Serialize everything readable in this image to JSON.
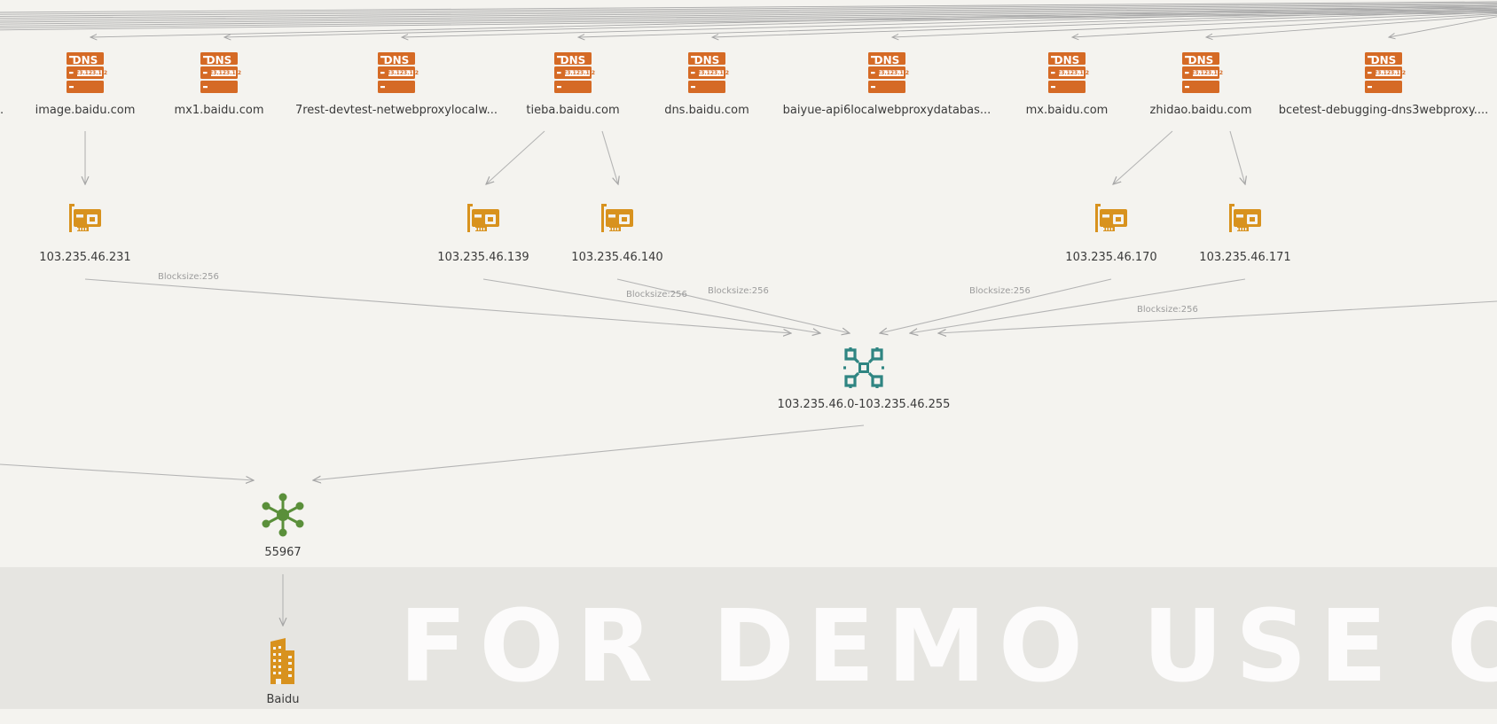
{
  "colors": {
    "background": "#f4f3ef",
    "dns": "#d56a25",
    "netcard": "#d8921e",
    "block": "#2f8582",
    "asn": "#5a8f3a",
    "org": "#d8921e",
    "edge": "#b4b4b4"
  },
  "graph": {
    "dns_nodes": [
      {
        "id": "dns-image",
        "label": "image.baidu.com"
      },
      {
        "id": "dns-mx1",
        "label": "mx1.baidu.com"
      },
      {
        "id": "dns-7rest",
        "label": "7rest-devtest-netwebproxylocalw..."
      },
      {
        "id": "dns-tieba",
        "label": "tieba.baidu.com"
      },
      {
        "id": "dns-dns",
        "label": "dns.baidu.com"
      },
      {
        "id": "dns-baiyue",
        "label": "baiyue-api6localwebproxydatabas..."
      },
      {
        "id": "dns-mx",
        "label": "mx.baidu.com"
      },
      {
        "id": "dns-zhidao",
        "label": "zhidao.baidu.com"
      },
      {
        "id": "dns-bcetest",
        "label": "bcetest-debugging-dns3webproxy...."
      }
    ],
    "ip_nodes": [
      {
        "id": "ip-231",
        "label": "103.235.46.231"
      },
      {
        "id": "ip-139",
        "label": "103.235.46.139"
      },
      {
        "id": "ip-140",
        "label": "103.235.46.140"
      },
      {
        "id": "ip-170",
        "label": "103.235.46.170"
      },
      {
        "id": "ip-171",
        "label": "103.235.46.171"
      }
    ],
    "block_node": {
      "id": "block",
      "label": "103.235.46.0-103.235.46.255"
    },
    "asn_node": {
      "id": "asn",
      "label": "55967"
    },
    "org_node": {
      "id": "org",
      "label": "Baidu"
    },
    "icons": {
      "dns": "dns-server-icon",
      "ip": "network-card-icon",
      "block": "ip-block-icon",
      "asn": "asn-hub-icon",
      "org": "organization-building-icon"
    },
    "dns_badge_text": "DNS",
    "dns_badge_subtext": "123.123.1.2",
    "edge_labels": [
      "Blocksize:256",
      "Blocksize:256",
      "Blocksize:256",
      "Blocksize:256",
      "Blocksize:256"
    ],
    "watermark": "FOR DEMO USE ONLY",
    "cutoff_dot": "."
  }
}
